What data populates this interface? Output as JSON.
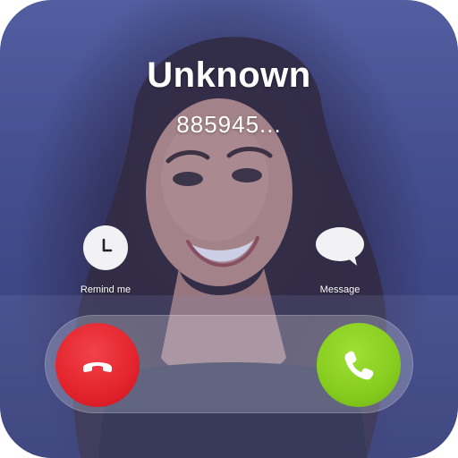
{
  "caller": {
    "name": "Unknown",
    "number": "885945..."
  },
  "actions": {
    "remind_label": "Remind me",
    "message_label": "Message"
  },
  "icons": {
    "remind": "clock-icon",
    "message": "speech-bubble-icon",
    "decline": "phone-hangup-icon",
    "accept": "phone-icon"
  },
  "colors": {
    "decline": "#e3232d",
    "accept": "#86cc1f",
    "text": "#ffffff"
  }
}
